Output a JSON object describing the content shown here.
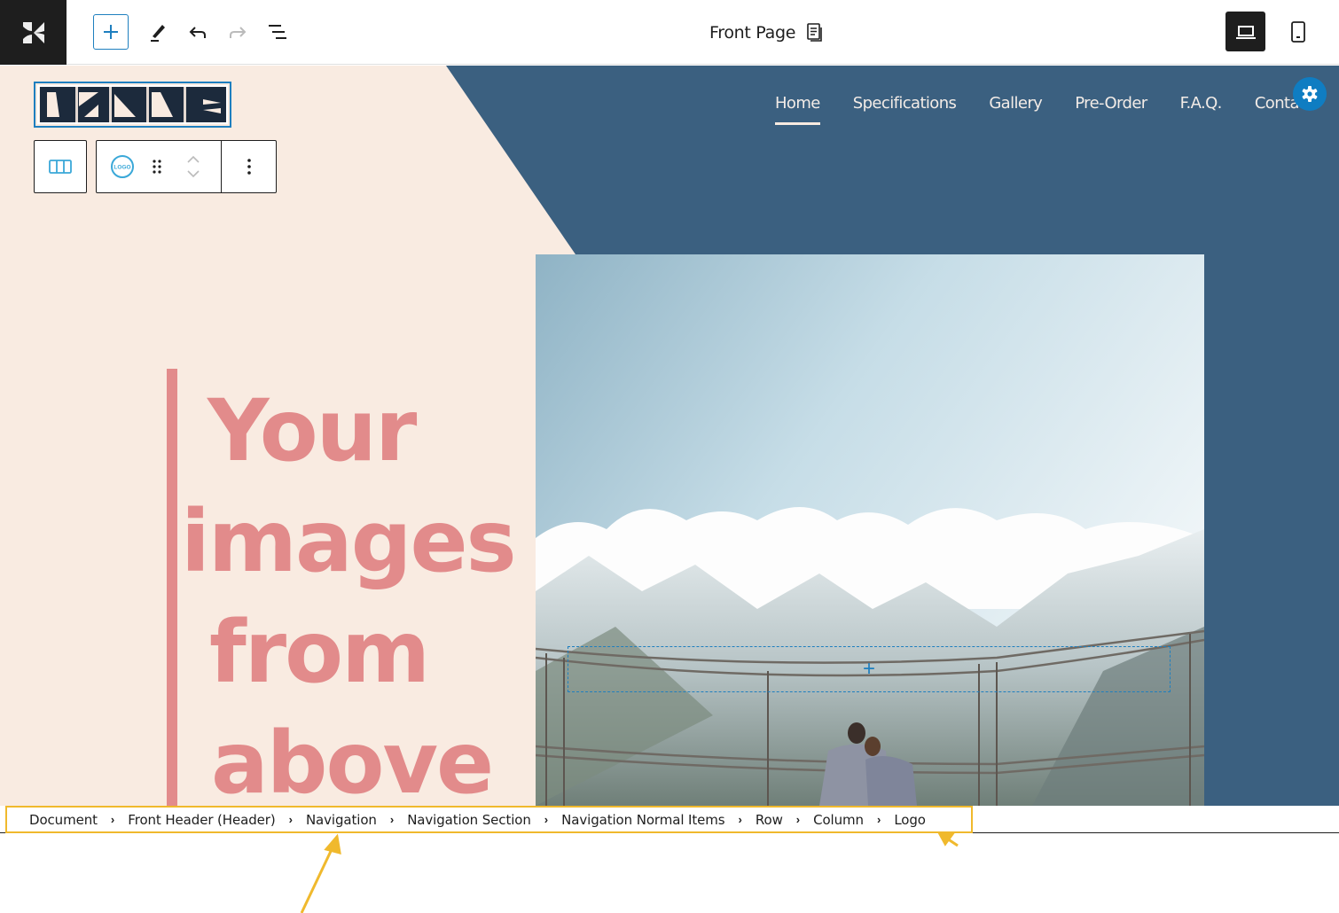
{
  "topbar": {
    "site_logo_icon": "site-editor-logo",
    "add_block_label": "+",
    "tools": [
      "add-block",
      "edit-tool",
      "undo",
      "redo",
      "document-overview"
    ],
    "document_title": "Front Page",
    "document_icon": "page-icon",
    "devices": [
      {
        "name": "desktop",
        "active": true
      },
      {
        "name": "mobile",
        "active": false
      }
    ]
  },
  "site": {
    "logo_text": "DRONE",
    "nav": [
      {
        "label": "Home",
        "active": true
      },
      {
        "label": "Specifications",
        "active": false
      },
      {
        "label": "Gallery",
        "active": false
      },
      {
        "label": "Pre-Order",
        "active": false
      },
      {
        "label": "F.A.Q.",
        "active": false
      },
      {
        "label": "Contact",
        "active": false
      }
    ],
    "headline": [
      "Your",
      "images",
      "from",
      "above"
    ],
    "colors": {
      "cream": "#f9ebe1",
      "navy": "#3b6080",
      "pink": "#e28b8b",
      "accent": "#1e7fbf"
    }
  },
  "block_toolbar": {
    "parent_icon": "columns-icon",
    "block_icon_text": "LOGO",
    "drag_icon": "drag-handle-icon",
    "move_up_icon": "chevron-up-icon",
    "move_down_icon": "chevron-down-icon",
    "more_icon": "more-vertical-icon"
  },
  "placeholder": {
    "label": "+"
  },
  "breadcrumb": [
    "Document",
    "Front Header (Header)",
    "Navigation",
    "Navigation Section",
    "Navigation Normal Items",
    "Row",
    "Column",
    "Logo"
  ]
}
